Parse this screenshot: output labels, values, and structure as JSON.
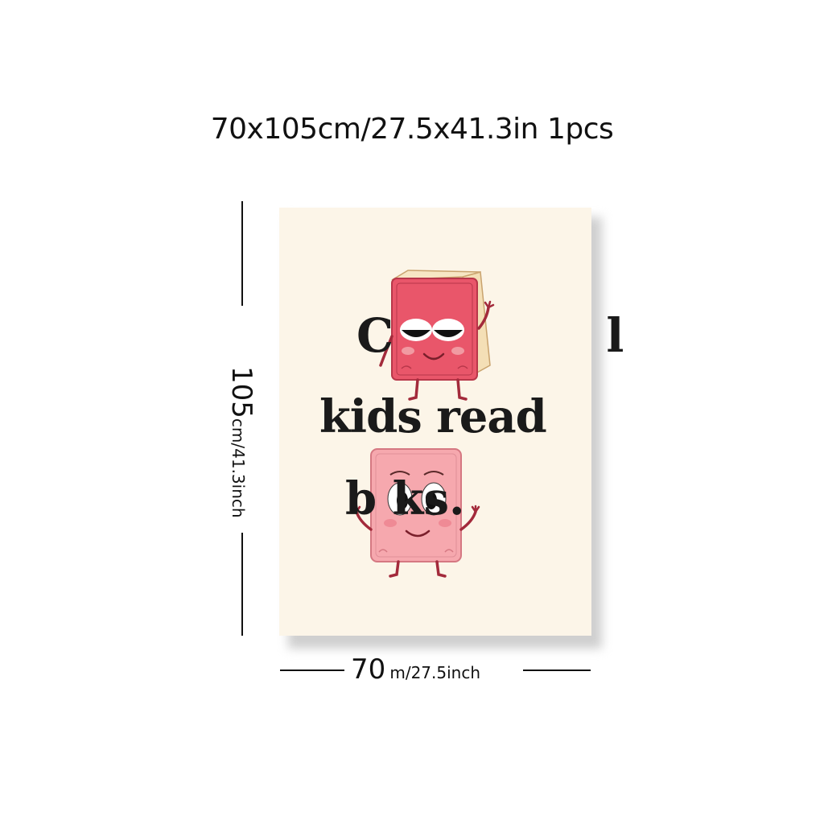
{
  "caption": "70x105cm/27.5x41.3in 1pcs",
  "height_dimension": {
    "value": "105",
    "unit": "cm/41.3inch"
  },
  "width_dimension": {
    "value": "70",
    "unit": "m/27.5inch"
  },
  "poster": {
    "line1": "C l",
    "line2": "kids read",
    "line3": "b ks."
  },
  "colors": {
    "background": "#ffffff",
    "poster": "#fcf5e8",
    "book_top": "#e9566a",
    "book_bottom": "#f6a8ae",
    "text": "#1a1a1a"
  },
  "icons": [
    "cool-book-icon",
    "happy-book-icon"
  ]
}
